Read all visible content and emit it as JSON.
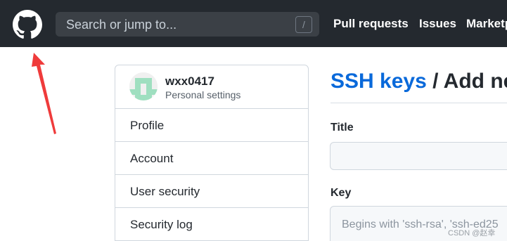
{
  "topbar": {
    "logo_icon": "github-octocat-icon",
    "search_placeholder": "Search or jump to...",
    "search_shortcut": "/",
    "nav": [
      "Pull requests",
      "Issues",
      "Marketp"
    ]
  },
  "annotation": {
    "arrow_color": "#ef3b3b"
  },
  "sidebar": {
    "username": "wxx0417",
    "subtitle": "Personal settings",
    "items": [
      "Profile",
      "Account",
      "User security",
      "Security log"
    ]
  },
  "main": {
    "breadcrumb": "SSH keys",
    "separator": " / ",
    "heading_rest": "Add new",
    "title_label": "Title",
    "key_label": "Key",
    "key_placeholder": "Begins with 'ssh-rsa', 'ssh-ed25"
  },
  "watermark": "CSDN @赵幸",
  "colors": {
    "topbar": "#24292f",
    "link": "#0969da",
    "avatar": "#9fdfc0"
  }
}
